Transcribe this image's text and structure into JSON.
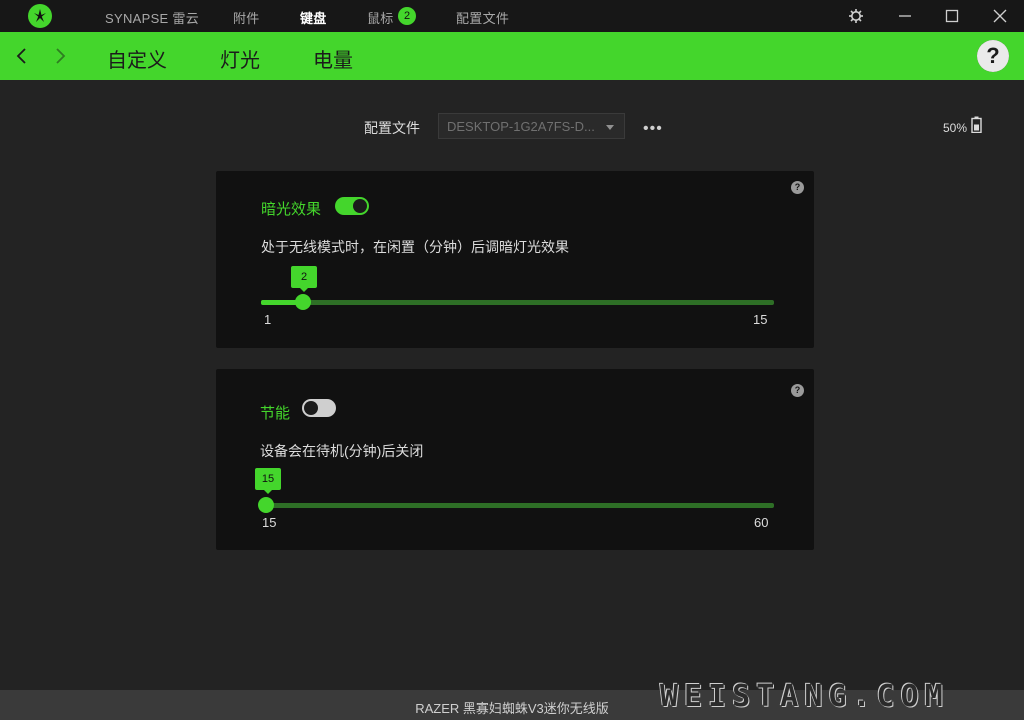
{
  "titlebar": {
    "nav": [
      {
        "label": "SYNAPSE 雷云",
        "active": false
      },
      {
        "label": "附件",
        "active": false
      },
      {
        "label": "键盘",
        "active": true
      },
      {
        "label": "鼠标",
        "active": false,
        "badge": "2"
      },
      {
        "label": "配置文件",
        "active": false
      }
    ],
    "icons": [
      "razer-logo-icon",
      "settings-gear-icon",
      "minimize-icon",
      "maximize-icon",
      "close-icon"
    ]
  },
  "subnav": {
    "tabs": [
      {
        "label": "自定义",
        "active": false
      },
      {
        "label": "灯光",
        "active": false
      },
      {
        "label": "电量",
        "active": true
      }
    ],
    "help": "?"
  },
  "profile": {
    "label": "配置文件",
    "value": "DESKTOP-1G2A7FS-D...",
    "more": "•••"
  },
  "battery": {
    "percent_text": "50%",
    "level": 0.5
  },
  "dim_panel": {
    "title": "暗光效果",
    "enabled": true,
    "description": "处于无线模式时，在闲置（分钟）后调暗灯光效果",
    "value": "2",
    "min": "1",
    "max": "15",
    "help": "?"
  },
  "power_panel": {
    "title": "节能",
    "enabled": false,
    "description": "设备会在待机(分钟)后关闭",
    "value": "15",
    "min": "15",
    "max": "60",
    "help": "?"
  },
  "footer": {
    "device": "RAZER 黑寡妇蜘蛛V3迷你无线版",
    "watermark": "WEISTANG.COM"
  },
  "colors": {
    "accent": "#44d62c",
    "panel": "#111111",
    "background": "#232323"
  }
}
